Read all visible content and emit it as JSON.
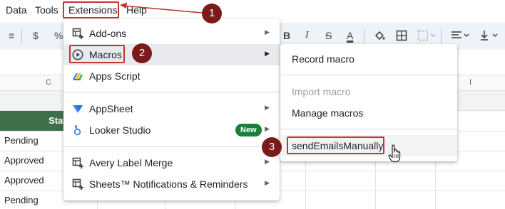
{
  "menubar": {
    "data": "Data",
    "tools": "Tools",
    "extensions": "Extensions",
    "help": "Help"
  },
  "toolbar": {
    "currency": "$",
    "percent": "%",
    "bold": "B",
    "italic": "I",
    "strikethrough": "S",
    "text_color": "A"
  },
  "sheet": {
    "columns": {
      "c": "C",
      "i": "I"
    },
    "status_header": "Status",
    "statuses": [
      "Pending",
      "Approved",
      "Approved",
      "Pending"
    ]
  },
  "extensions_menu": {
    "items": [
      {
        "label": "Add-ons",
        "icon": "addon-icon",
        "has_submenu": true
      },
      {
        "label": "Macros",
        "icon": "play-circle-icon",
        "has_submenu": true
      },
      {
        "label": "Apps Script",
        "icon": "apps-script-icon",
        "has_submenu": false
      },
      {
        "label": "AppSheet",
        "icon": "appsheet-icon",
        "has_submenu": true
      },
      {
        "label": "Looker Studio",
        "icon": "looker-studio-icon",
        "has_submenu": true,
        "badge": "New"
      },
      {
        "label": "Avery Label Merge",
        "icon": "addon-icon",
        "has_submenu": true
      },
      {
        "label": "Sheets™ Notifications & Reminders",
        "icon": "addon-icon",
        "has_submenu": true
      }
    ]
  },
  "macros_submenu": {
    "record": "Record macro",
    "import": "Import macro",
    "manage": "Manage macros",
    "macro": "sendEmailsManually"
  },
  "callouts": [
    "1",
    "2",
    "3"
  ],
  "colors": {
    "accent_red": "#c0392b",
    "callout_bg": "#7b1a1a",
    "header_green": "#3e6e4a",
    "badge_green": "#188038"
  }
}
